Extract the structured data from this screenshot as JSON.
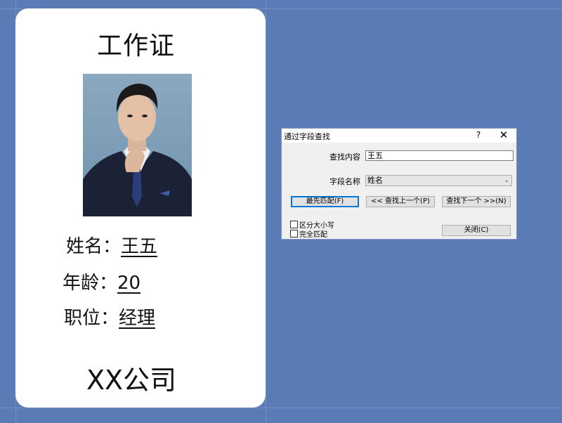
{
  "card": {
    "title": "工作证",
    "fields": [
      {
        "label": "姓名：",
        "value": "王五"
      },
      {
        "label": "年龄：",
        "value": "20"
      },
      {
        "label": "职位：",
        "value": "经理"
      }
    ],
    "company": "XX公司"
  },
  "dialog": {
    "title": "通过字段查找",
    "help": "?",
    "close": "✕",
    "search_label": "查找内容",
    "search_value": "王五",
    "field_label": "字段名称",
    "field_value": "姓名",
    "buttons": {
      "first": "最先匹配(F)",
      "prev": "<< 查找上一个(P)",
      "next": "查找下一个 >>(N)",
      "close": "关闭(C)"
    },
    "options": {
      "case": "区分大小写",
      "whole": "完全匹配"
    }
  },
  "colors": {
    "background": "#5a7bb5",
    "card": "#ffffff",
    "dialog": "#f0f0f0",
    "accent": "#0078d7"
  }
}
